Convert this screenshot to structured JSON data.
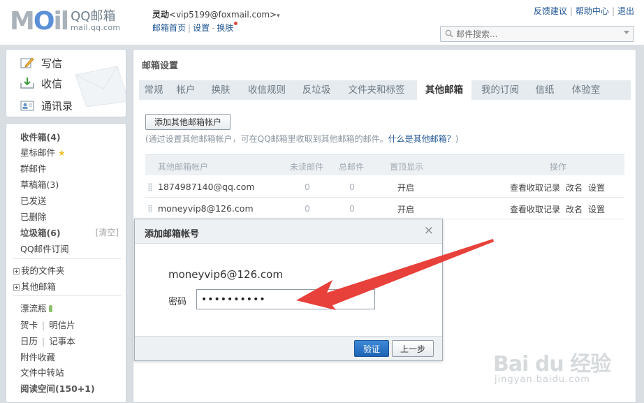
{
  "header": {
    "logo": {
      "brand": "MOil",
      "qq": "QQ邮箱",
      "url": "mail.qq.com"
    },
    "user": {
      "nick": "灵动",
      "email": "<vip5199@foxmail.com>",
      "caret": "▾"
    },
    "links": {
      "home": "邮箱首页",
      "settings": "设置",
      "skin": "换肤",
      "sep": "|",
      "dash": "-"
    },
    "top_right": {
      "feedback": "反馈建议",
      "help": "帮助中心",
      "logout": "退出",
      "sep": "|"
    },
    "search": {
      "placeholder": "邮件搜索..."
    }
  },
  "sidebar": {
    "compose": "写信",
    "inbox_top": "收信",
    "contacts": "通讯录",
    "items": {
      "inbox": "收件箱(4)",
      "starred": "星标邮件",
      "group": "群邮件",
      "drafts": "草稿箱(3)",
      "sent": "已发送",
      "deleted": "已删除",
      "spam": "垃圾箱(6)",
      "clean": "[清空]",
      "subscriptions": "QQ邮件订阅",
      "my_folders": "我的文件夹",
      "other_mailboxes": "其他邮箱",
      "drift_bottle": "漂流瓶",
      "cards": "贺卡",
      "postcards": "明信片",
      "calendar": "日历",
      "notebook": "记事本",
      "attachments": "附件收藏",
      "transfer": "文件中转站",
      "reading": "阅读空间(150+1)"
    }
  },
  "main": {
    "title": "邮箱设置",
    "tabs": [
      "常规",
      "帐户",
      "换肤",
      "收信规则",
      "反垃圾",
      "文件夹和标签",
      "其他邮箱",
      "我的订阅",
      "信纸",
      "体验室"
    ],
    "active_tab_index": 6,
    "add_button": "添加其他邮箱帐户",
    "hint_prefix": "(通过设置其他邮箱帐户，可在QQ邮箱里收取到其他邮箱的邮件。",
    "hint_link": "什么是其他邮箱？",
    "hint_suffix": ")",
    "table": {
      "headers": [
        "其他邮箱帐户",
        "未读邮件",
        "总邮件",
        "置顶显示",
        "操作"
      ],
      "rows": [
        {
          "account": "1874987140@qq.com",
          "unread": "0",
          "total": "0",
          "pin": "开启",
          "ops": [
            "查看收取记录",
            "改名",
            "设置"
          ]
        },
        {
          "account": "moneyvip8@126.com",
          "unread": "0",
          "total": "0",
          "pin": "开启",
          "ops": [
            "查看收取记录",
            "改名",
            "设置"
          ]
        }
      ]
    }
  },
  "modal": {
    "title": "添加邮箱帐号",
    "close": "×",
    "email": "moneyvip6@126.com",
    "password_label": "密码",
    "password_value": "••••••••••",
    "verify_button": "验证",
    "back_button": "上一步"
  },
  "annotation": {
    "arrow_color": "#e8403a"
  },
  "watermark": {
    "main": "Bai du 经验",
    "sub": "jingyan.baidu.com"
  },
  "colors": {
    "link": "#1e5494",
    "frame": "#d9dee3",
    "primary_button": "#2b74c7"
  }
}
